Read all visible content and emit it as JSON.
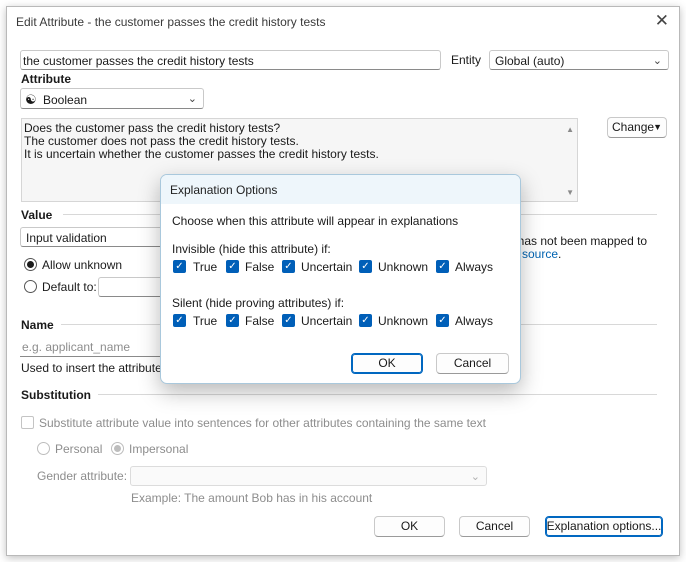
{
  "window": {
    "title": "Edit Attribute - the customer passes the credit history tests",
    "close_glyph": "✕"
  },
  "main": {
    "attribute_text_value": "the customer passes the credit history tests",
    "entity_label": "Entity",
    "entity_value": "Global (auto)",
    "attribute_heading": "Attribute",
    "type_icon_glyph": "☯",
    "type_value": "Boolean",
    "description_lines": [
      "Does the customer pass the credit history tests?",
      "The customer does not pass the credit history tests.",
      "It is uncertain whether the customer passes the credit history tests."
    ],
    "change_button": "Change",
    "value_heading": "Value",
    "value_select": "Input validation",
    "allow_unknown_label": "Allow unknown",
    "default_to_label": "Default to:",
    "partial_text_1": "t has not been mapped to",
    "partial_link": "source",
    "partial_suffix": ".",
    "name_heading": "Name",
    "name_placeholder": "e.g. applicant_name",
    "name_help_partial": "Used to insert the attribute's va",
    "substitution_heading": "Substitution",
    "substitute_checkbox_label": "Substitute attribute value into sentences for other attributes containing the same text",
    "personal_label": "Personal",
    "impersonal_label": "Impersonal",
    "gender_label": "Gender attribute:",
    "gender_value": "",
    "example_text": "Example: The amount Bob has in his account",
    "ok_button": "OK",
    "cancel_button": "Cancel",
    "explanation_button": "Explanation options..."
  },
  "modal": {
    "title": "Explanation Options",
    "intro": "Choose when this attribute will appear in explanations",
    "invisible_label": "Invisible (hide this attribute) if:",
    "silent_label": "Silent (hide proving attributes) if:",
    "options": [
      "True",
      "False",
      "Uncertain",
      "Unknown",
      "Always"
    ],
    "check_glyph": "✓",
    "ok_button": "OK",
    "cancel_button": "Cancel"
  },
  "colors": {
    "accent": "#005fb8",
    "link": "#0063b1",
    "modal_header": "#eef6fb"
  }
}
